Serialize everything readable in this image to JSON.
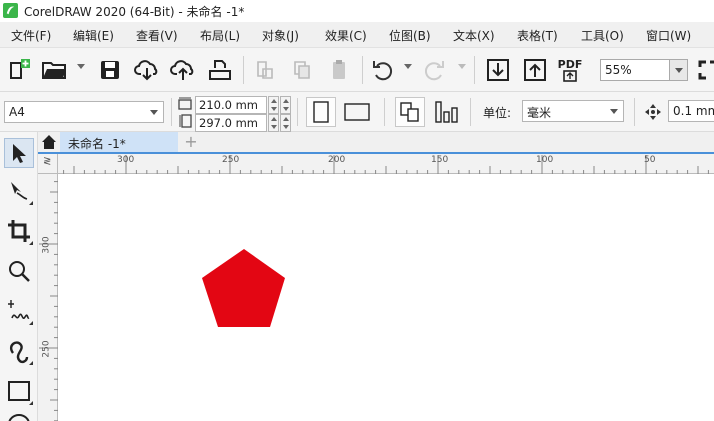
{
  "titlebar": {
    "title": "CorelDRAW 2020 (64-Bit) - 未命名 -1*",
    "logo_icon": "coreldraw-logo-icon",
    "logo_color": "#3bb54a"
  },
  "menubar": {
    "items": [
      "文件(F)",
      "编辑(E)",
      "查看(V)",
      "布局(L)",
      "对象(J)",
      "效果(C)",
      "位图(B)",
      "文本(X)",
      "表格(T)",
      "工具(O)",
      "窗口(W)"
    ]
  },
  "toolbar": {
    "icons": [
      "new-document-icon",
      "open-folder-icon",
      "save-icon",
      "cloud-download-icon",
      "cloud-upload-icon",
      "print-icon",
      "cut-icon",
      "copy-icon",
      "paste-icon",
      "undo-icon",
      "redo-icon",
      "import-icon",
      "export-icon",
      "export-pdf-icon"
    ],
    "pdf_label": "PDF",
    "zoom_value": "55%"
  },
  "property_bar": {
    "page_size": "A4",
    "page_width": "210.0 mm",
    "page_height": "297.0 mm",
    "unit_label": "单位:",
    "unit_value": "毫米",
    "nudge_value": "0.1 mm"
  },
  "toolbox": {
    "tools": [
      "pick-tool-icon",
      "shape-tool-icon",
      "crop-tool-icon",
      "zoom-tool-icon",
      "freehand-tool-icon",
      "artistic-media-tool-icon",
      "rectangle-tool-icon",
      "ellipse-tool-icon"
    ]
  },
  "document_tabs": {
    "active_tab": "未命名 -1*",
    "add_tab": "+"
  },
  "rulers": {
    "horizontal_labels": [
      "300",
      "250",
      "200",
      "150",
      "100",
      "50"
    ],
    "vertical_labels": [
      "300",
      "250"
    ],
    "corner_mark": "≷"
  },
  "canvas": {
    "shape": "pentagon",
    "fill_color": "#e30613"
  }
}
